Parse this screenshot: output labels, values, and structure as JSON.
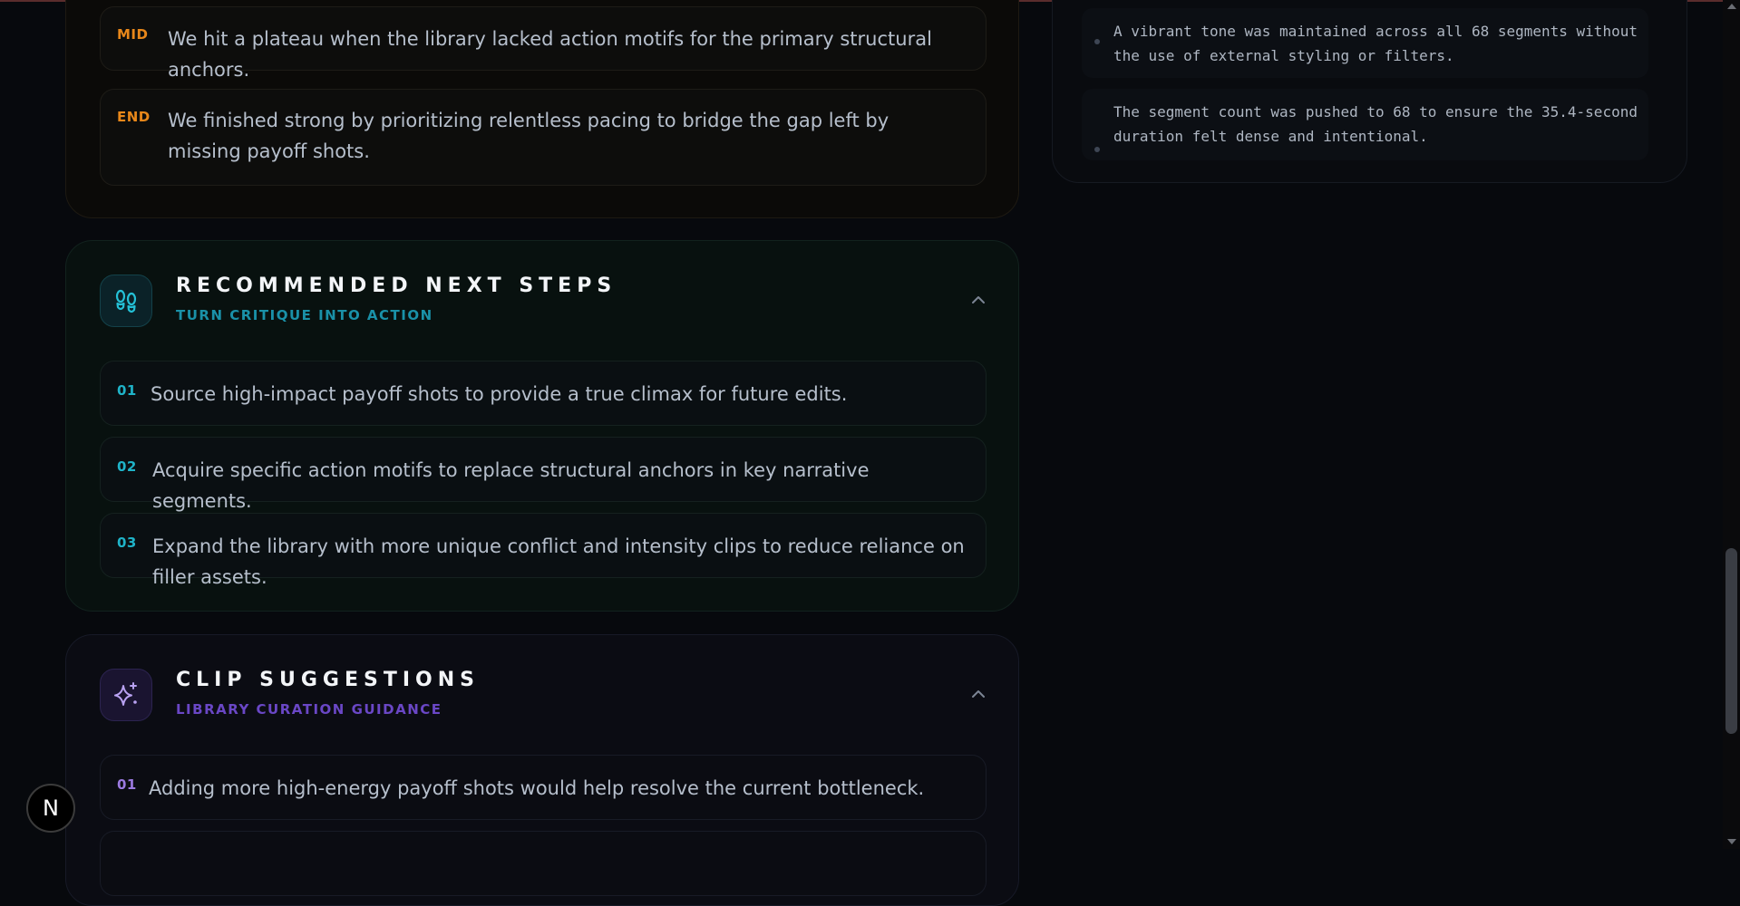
{
  "story": {
    "beats": [
      {
        "tag": "MID",
        "text": "We hit a plateau when the library lacked action motifs for the primary structural anchors."
      },
      {
        "tag": "END",
        "text": "We finished strong by prioritizing relentless pacing to bridge the gap left by missing payoff shots."
      }
    ]
  },
  "notes": {
    "items": [
      "A vibrant tone was maintained across all 68 segments without the use of external styling or filters.",
      "The segment count was pushed to 68 to ensure the 35.4-second duration felt dense and intentional."
    ]
  },
  "next_steps": {
    "title": "RECOMMENDED NEXT STEPS",
    "subtitle": "TURN CRITIQUE INTO ACTION",
    "icon": "footprints-icon",
    "items": [
      {
        "num": "01",
        "text": "Source high-impact payoff shots to provide a true climax for future edits."
      },
      {
        "num": "02",
        "text": "Acquire specific action motifs to replace structural anchors in key narrative segments."
      },
      {
        "num": "03",
        "text": "Expand the library with more unique conflict and intensity clips to reduce reliance on filler assets."
      }
    ]
  },
  "clip_suggestions": {
    "title": "CLIP SUGGESTIONS",
    "subtitle": "LIBRARY CURATION GUIDANCE",
    "icon": "sparkles-icon",
    "items": [
      {
        "num": "01",
        "text": "Adding more high-energy payoff shots would help resolve the current bottleneck."
      }
    ]
  },
  "devtools": {
    "badge": "N"
  },
  "colors": {
    "amber": "#e8871a",
    "teal": "#1fb3c8",
    "violet": "#9b7ae0",
    "background": "#07090d"
  }
}
